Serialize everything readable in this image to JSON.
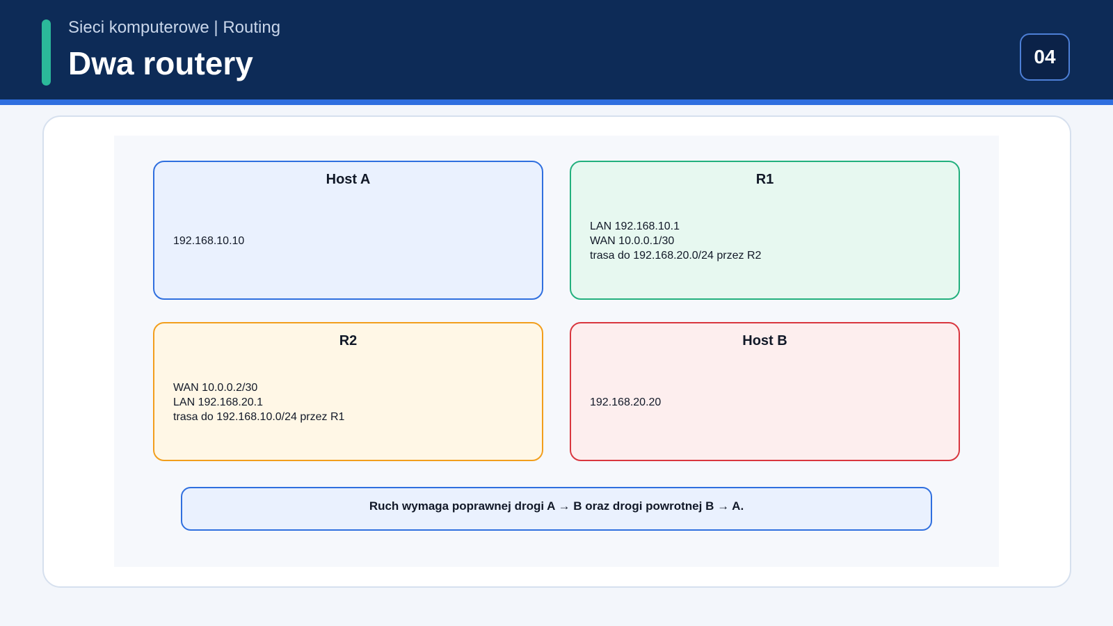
{
  "header": {
    "subtitle": "Sieci komputerowe | Routing",
    "title": "Dwa routery",
    "page_number": "04"
  },
  "diagram": {
    "nodes": [
      {
        "title": "Host A",
        "lines": [
          "192.168.10.10"
        ]
      },
      {
        "title": "R1",
        "lines": [
          "LAN 192.168.10.1",
          "WAN 10.0.0.1/30",
          "trasa do 192.168.20.0/24 przez R2"
        ]
      },
      {
        "title": "R2",
        "lines": [
          "WAN 10.0.0.2/30",
          "LAN 192.168.20.1",
          "trasa do 192.168.10.0/24 przez R1"
        ]
      },
      {
        "title": "Host B",
        "lines": [
          "192.168.20.20"
        ]
      }
    ],
    "note": "Ruch wymaga poprawnej drogi A → B oraz drogi powrotnej B → A."
  },
  "colors": {
    "header_bg": "#0d2b57",
    "accent": "#2bb99a",
    "rule": "#2f6fdf",
    "host_a": "#2f6fdf",
    "r1": "#22b07d",
    "r2": "#f29e1c",
    "host_b": "#d9363e"
  }
}
